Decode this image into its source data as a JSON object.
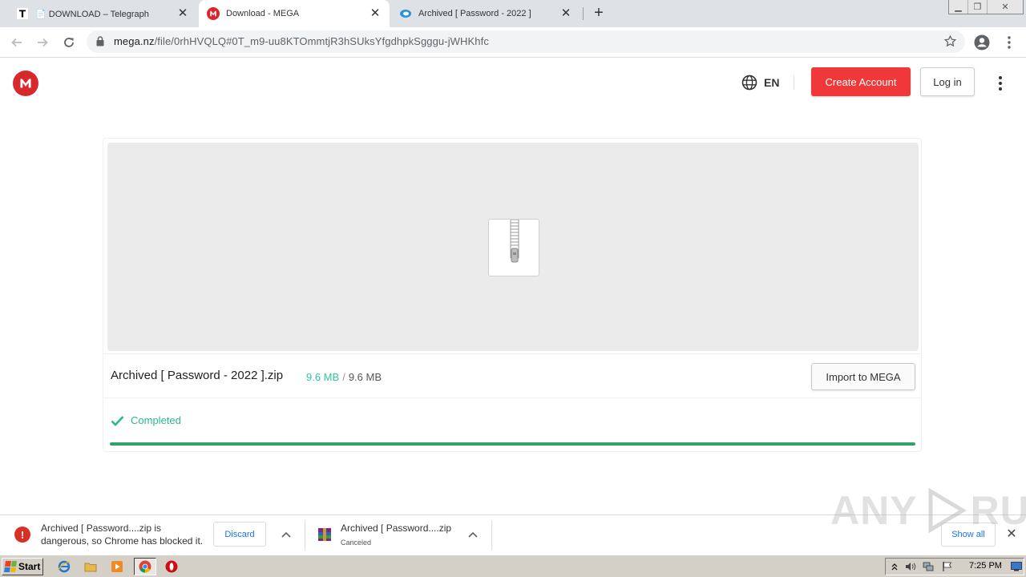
{
  "browser": {
    "tabs": [
      {
        "title": "📄 DOWNLOAD – Telegraph",
        "favicon": "telegraph-t-icon",
        "active": false
      },
      {
        "title": "Download - MEGA",
        "favicon": "mega-icon",
        "active": true
      },
      {
        "title": "Archived [ Password - 2022 ]",
        "favicon": "cloud-icon",
        "active": false
      }
    ],
    "url_host": "mega.nz",
    "url_path": "/file/0rhHVQLQ#0T_m9-uu8KTOmmtjR3hSUksYfgdhpkSgggu-jWHKhfc"
  },
  "mega": {
    "logo_letter": "M",
    "language": "EN",
    "create_account": "Create Account",
    "login": "Log in",
    "brand_red": "#d9272e"
  },
  "file": {
    "name": "Archived [ Password - 2022 ].zip",
    "downloaded": "9.6 MB",
    "separator": "/",
    "total": "9.6 MB",
    "import_label": "Import to MEGA",
    "status": "Completed",
    "progress": 1.0,
    "status_color": "#2bb594"
  },
  "downloads": {
    "item1_line1": "Archived [ Password....zip is",
    "item1_line2": "dangerous, so Chrome has blocked it.",
    "discard": "Discard",
    "item2_name": "Archived [ Password....zip",
    "item2_status": "Canceled",
    "show_all": "Show all",
    "watermark_left": "ANY",
    "watermark_right": "RUN"
  },
  "taskbar": {
    "start": "Start",
    "clock": "7:25 PM"
  }
}
